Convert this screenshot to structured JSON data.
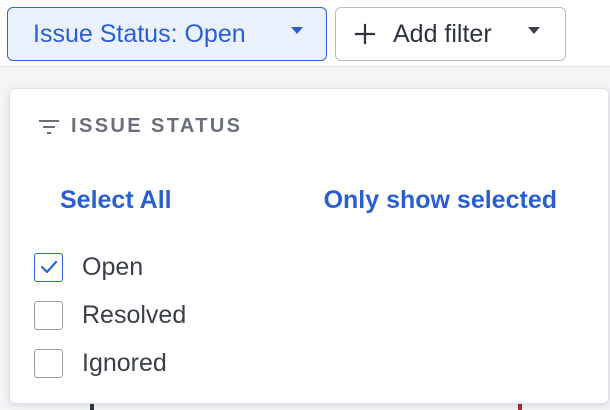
{
  "filter_bar": {
    "status_chip_label": "Issue Status: Open",
    "add_filter_label": "Add filter"
  },
  "dropdown": {
    "title": "ISSUE STATUS",
    "select_all_label": "Select All",
    "only_show_selected_label": "Only show selected",
    "options": [
      {
        "label": "Open",
        "checked": true
      },
      {
        "label": "Resolved",
        "checked": false
      },
      {
        "label": "Ignored",
        "checked": false
      }
    ]
  },
  "colors": {
    "accent": "#2a5fd4",
    "chip_active_bg": "#eaf1fd",
    "text": "#3a3f4a",
    "muted": "#6a6f7c"
  },
  "icons": {
    "filter": "filter-icon",
    "plus": "plus-icon",
    "caret": "caret-down-icon",
    "check": "checkmark-icon"
  }
}
